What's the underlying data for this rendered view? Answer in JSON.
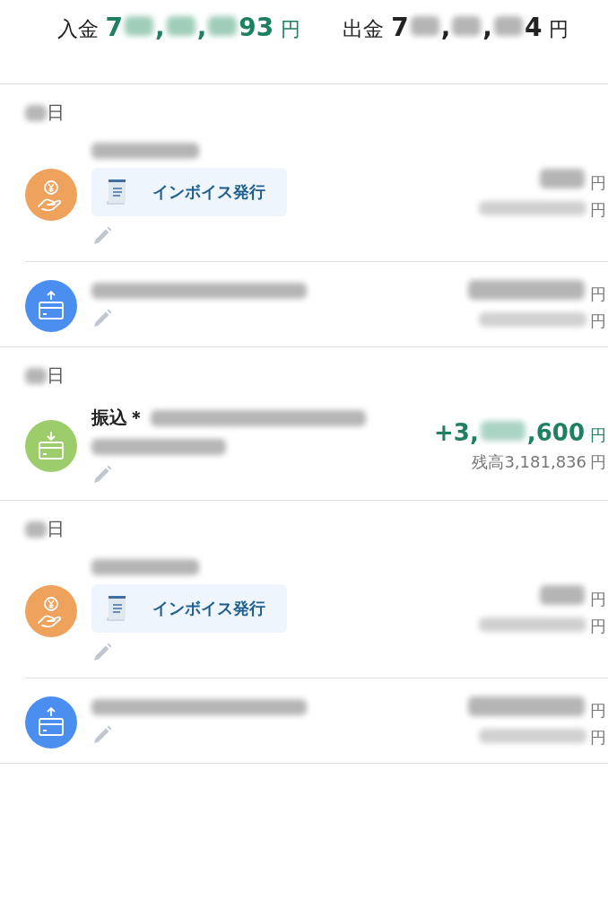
{
  "summary": [
    {
      "label": "入金",
      "kind": "income",
      "amount": [
        {
          "kind": "text",
          "text": "7"
        },
        {
          "kind": "blur"
        },
        {
          "kind": "text",
          "text": ","
        },
        {
          "kind": "blur"
        },
        {
          "kind": "text",
          "text": ","
        },
        {
          "kind": "blur"
        },
        {
          "kind": "text",
          "text": "93"
        }
      ],
      "unit": "円"
    },
    {
      "label": "出金",
      "kind": "expense",
      "amount": [
        {
          "kind": "text",
          "text": "7"
        },
        {
          "kind": "blur"
        },
        {
          "kind": "text",
          "text": ","
        },
        {
          "kind": "blur"
        },
        {
          "kind": "text",
          "text": ","
        },
        {
          "kind": "blur"
        },
        {
          "kind": "text",
          "text": "4"
        }
      ],
      "unit": "円"
    }
  ],
  "days": [
    {
      "date": [
        {
          "kind": "blur"
        },
        {
          "kind": "text",
          "text": "日"
        }
      ],
      "transactions": [
        {
          "kind": "fee",
          "title": [
            {
              "kind": "blur_wide"
            }
          ],
          "invoice_button": "インボイス発行",
          "amount": [
            {
              "kind": "blur"
            }
          ],
          "amount_unit": "円",
          "balance": [
            {
              "kind": "blur_wide"
            }
          ],
          "balance_unit": "円"
        },
        {
          "kind": "withdrawal",
          "title": [
            {
              "kind": "blur_long"
            }
          ],
          "amount": [
            {
              "kind": "blur_wide"
            }
          ],
          "amount_unit": "円",
          "balance": [
            {
              "kind": "blur_wide"
            }
          ],
          "balance_unit": "円"
        }
      ]
    },
    {
      "date": [
        {
          "kind": "blur"
        },
        {
          "kind": "text",
          "text": "日"
        }
      ],
      "transactions": [
        {
          "kind": "deposit",
          "title": [
            {
              "kind": "text",
              "text": "振込＊"
            },
            {
              "kind": "blur_long"
            }
          ],
          "note": [
            {
              "kind": "blur_wide"
            }
          ],
          "amount": [
            {
              "kind": "text",
              "text": "+3,"
            },
            {
              "kind": "blur"
            },
            {
              "kind": "text",
              "text": ",600"
            }
          ],
          "amount_unit": "円",
          "balance": [
            {
              "kind": "text",
              "text": "残高3,181,836"
            }
          ],
          "balance_unit": "円"
        }
      ]
    },
    {
      "date": [
        {
          "kind": "blur"
        },
        {
          "kind": "text",
          "text": "日"
        }
      ],
      "transactions": [
        {
          "kind": "fee",
          "title": [
            {
              "kind": "blur_wide"
            }
          ],
          "invoice_button": "インボイス発行",
          "amount": [
            {
              "kind": "blur"
            }
          ],
          "amount_unit": "円",
          "balance": [
            {
              "kind": "blur_wide"
            }
          ],
          "balance_unit": "円"
        },
        {
          "kind": "withdrawal",
          "title": [
            {
              "kind": "blur_long"
            }
          ],
          "amount": [
            {
              "kind": "blur_wide"
            }
          ],
          "amount_unit": "円",
          "balance": [
            {
              "kind": "blur_wide"
            }
          ],
          "balance_unit": "円"
        }
      ]
    }
  ]
}
